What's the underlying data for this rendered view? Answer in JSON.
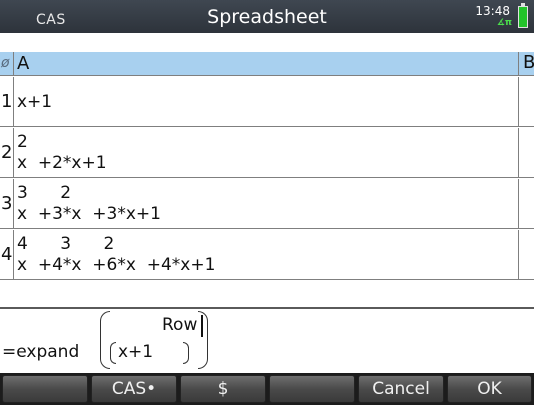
{
  "titlebar": {
    "mode": "CAS",
    "title": "Spreadsheet",
    "time": "13:48",
    "angle_indicator": "∡π",
    "battery_icon": "battery-full-icon"
  },
  "sheet": {
    "corner_icon": "ø",
    "columns": [
      "A",
      "B"
    ],
    "rows": [
      {
        "num": "1",
        "exponents": "",
        "base": "x+1"
      },
      {
        "num": "2",
        "exponents": "2",
        "base": "x  +2*x+1"
      },
      {
        "num": "3",
        "exponents": "3      2",
        "base": "x  +3*x  +3*x+1"
      },
      {
        "num": "4",
        "exponents": "4      3      2",
        "base": "x  +4*x  +6*x  +4*x+1"
      }
    ]
  },
  "entry": {
    "prefix": "=expand",
    "argument": "x+1",
    "upper": "Row"
  },
  "softkeys": [
    "",
    "CAS•",
    "$",
    "",
    "Cancel",
    "OK"
  ],
  "colors": {
    "header_bg": "#a8d0ef",
    "titlebar_bg": "#2d333b",
    "battery": "#22c32a",
    "angle": "#4be04b"
  }
}
